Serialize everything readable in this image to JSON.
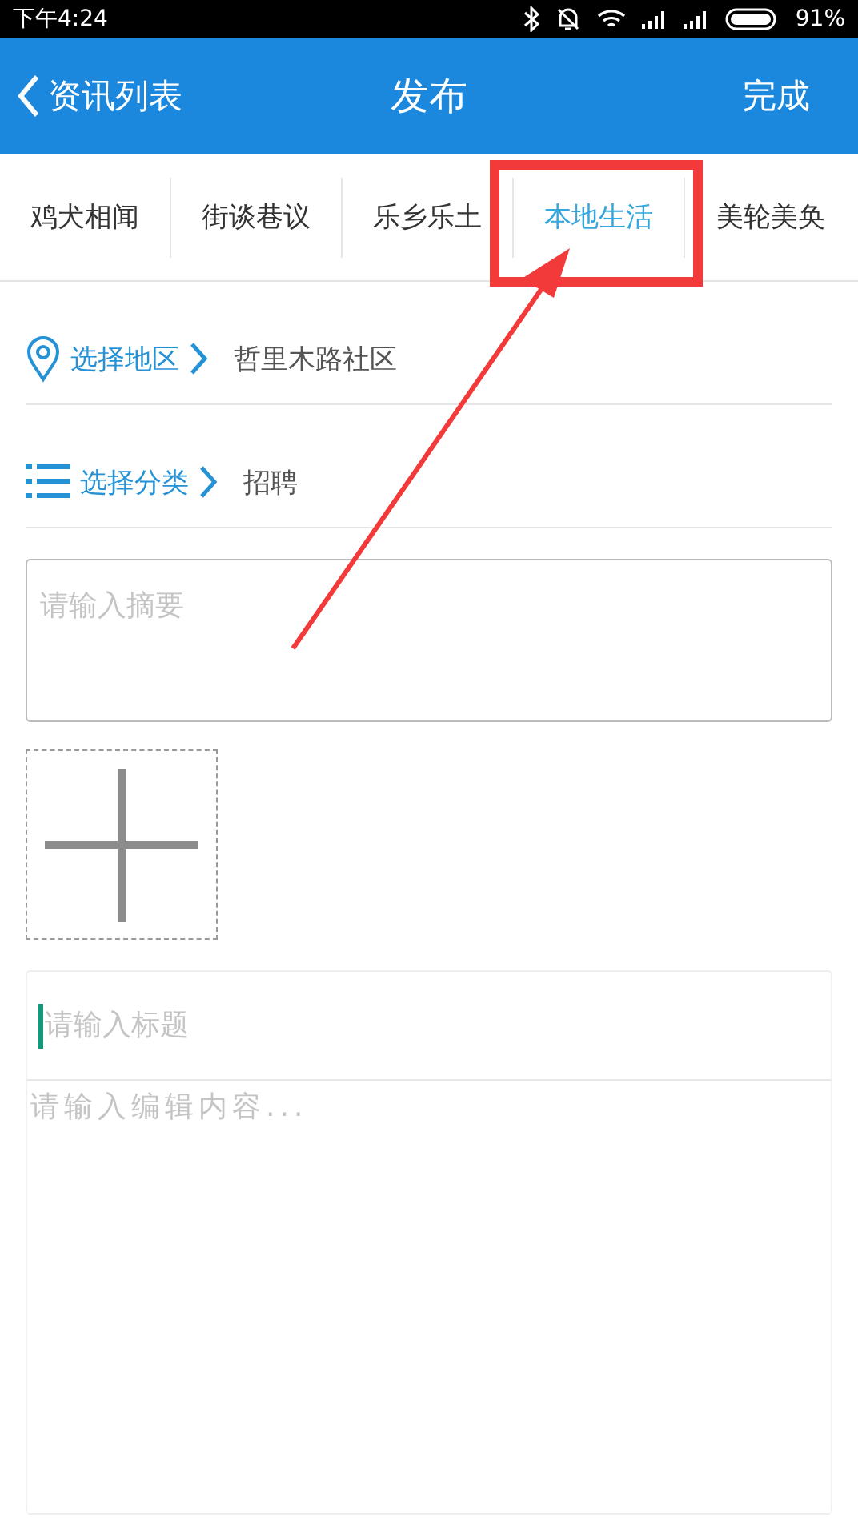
{
  "status_bar": {
    "time": "下午4:24",
    "battery": "91%"
  },
  "header": {
    "back": "资讯列表",
    "title": "发布",
    "action": "完成"
  },
  "tabs": [
    {
      "label": "鸡犬相闻",
      "selected": false
    },
    {
      "label": "街谈巷议",
      "selected": false
    },
    {
      "label": "乐乡乐土",
      "selected": false
    },
    {
      "label": "本地生活",
      "selected": true
    },
    {
      "label": "美轮美奂",
      "selected": false
    }
  ],
  "pickers": [
    {
      "kind": "location",
      "label": "选择地区",
      "value": "哲里木路社区"
    },
    {
      "kind": "category",
      "label": "选择分类",
      "value": "招聘"
    }
  ],
  "summary": {
    "placeholder": "请输入摘要"
  },
  "editor": {
    "title_placeholder": "请输入标题",
    "content_placeholder": "请输入编辑内容..."
  }
}
